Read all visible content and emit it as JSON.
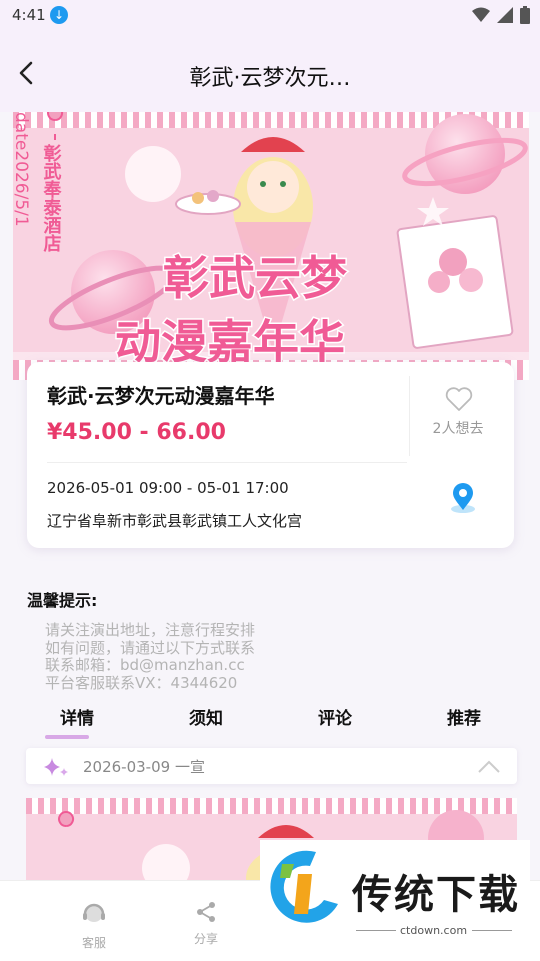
{
  "status_bar": {
    "time": "4:41"
  },
  "header": {
    "title": "彰武·云梦次元…"
  },
  "banner": {
    "vertical_info": "date2026/5/1",
    "venue_vertical": "彰武奉泰酒店",
    "headline_1": "彰武云梦",
    "headline_2": "动漫嘉年华"
  },
  "event": {
    "name": "彰武·云梦次元动漫嘉年华",
    "price": "¥45.00 - 66.00",
    "wish_count": "2人想去",
    "datetime": "2026-05-01 09:00 - 05-01 17:00",
    "address": "辽宁省阜新市彰武县彰武镇工人文化宫"
  },
  "tips": {
    "title": "温馨提示:",
    "lines": [
      "请关注演出地址，注意行程安排",
      "如有问题，请通过以下方式联系",
      "联系邮箱：bd@manzhan.cc",
      "平台客服联系VX：4344620"
    ]
  },
  "tabs": [
    {
      "label": "详情"
    },
    {
      "label": "须知"
    },
    {
      "label": "评论"
    },
    {
      "label": "推荐"
    }
  ],
  "announcement": {
    "date": "2026-03-09 一宣"
  },
  "bottom_bar": {
    "service_label": "客服",
    "share_label": "分享"
  },
  "watermark": {
    "brand": "传统下载",
    "site": "ctdown.com"
  },
  "colors": {
    "price": "#e83a6b",
    "banner_pink": "#f6b9cf",
    "tab_underline": "#d8a8e6",
    "accent_blue": "#1e9af0"
  }
}
